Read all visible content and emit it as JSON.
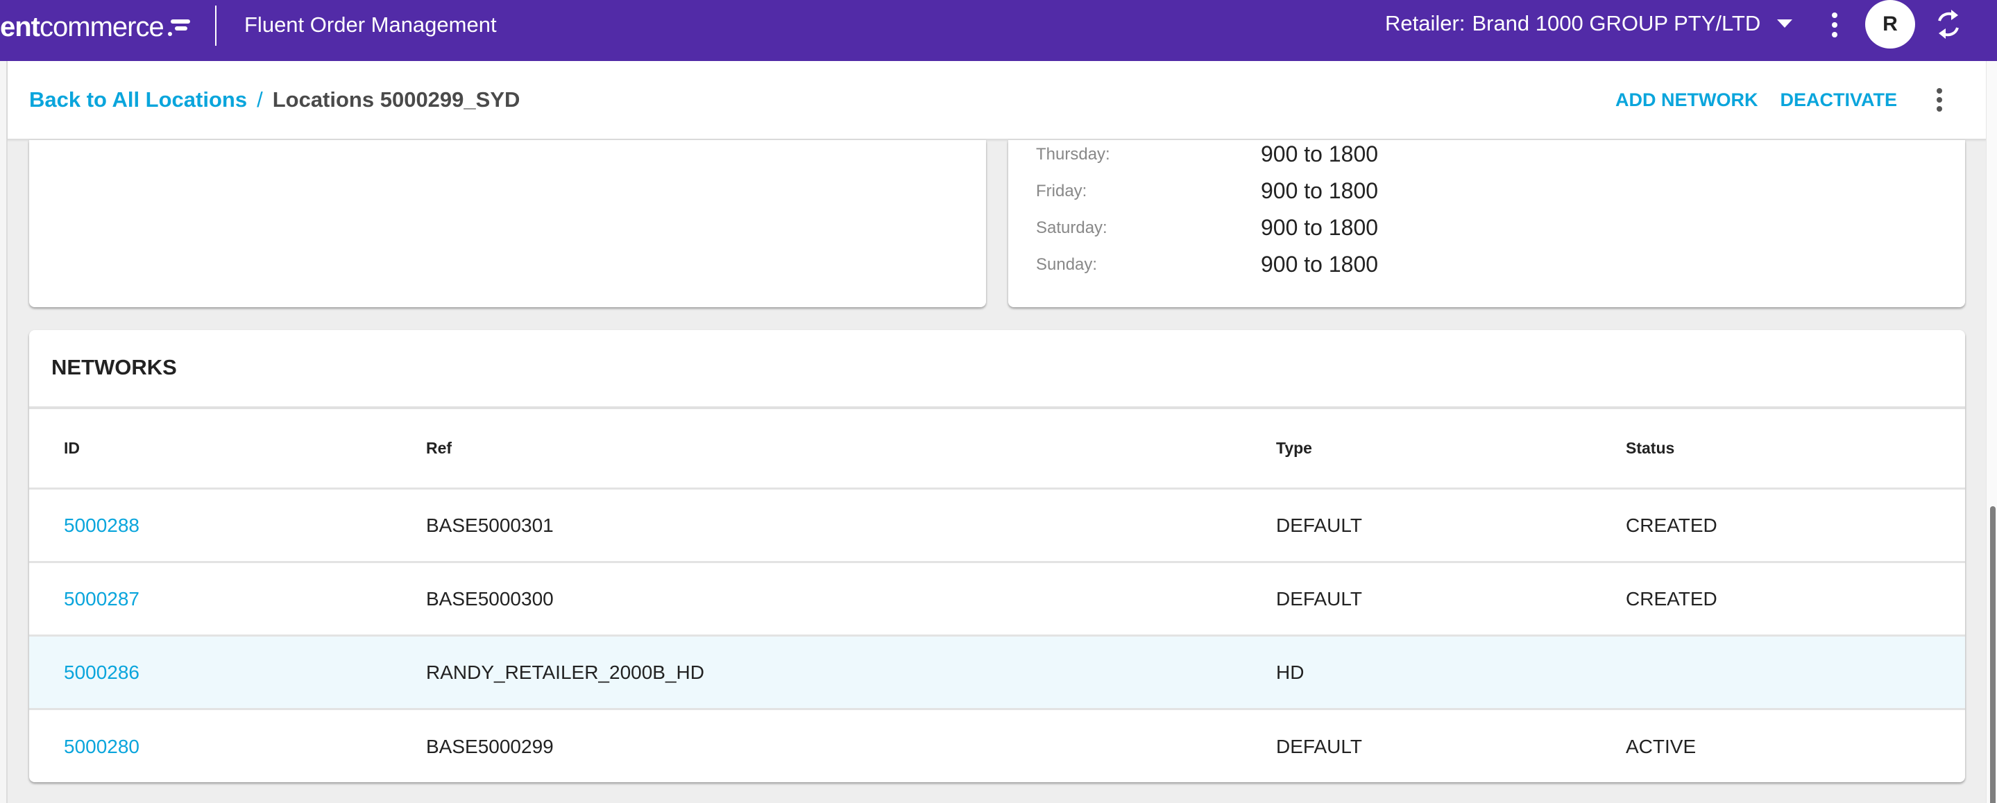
{
  "header": {
    "logo_text_bold": "ent",
    "logo_text_regular": "commerce",
    "app_title": "Fluent Order Management",
    "retailer_label": "Retailer:",
    "retailer_value": "Brand 1000 GROUP PTY/LTD",
    "avatar_initial": "R",
    "icons": {
      "menu": "more-vert-icon",
      "refresh": "refresh-icon",
      "dropdown": "caret-down-icon"
    },
    "colors": {
      "brand": "#522ba7"
    }
  },
  "breadcrumb": {
    "back_label": "Back to All Locations",
    "separator": "/",
    "current": "Locations 5000299_SYD"
  },
  "actions": {
    "add_network": "ADD NETWORK",
    "deactivate": "DEACTIVATE",
    "colors": {
      "link": "#0aa5dc"
    }
  },
  "opening_hours": [
    {
      "day": "Thursday:",
      "time": "900 to 1800"
    },
    {
      "day": "Friday:",
      "time": "900 to 1800"
    },
    {
      "day": "Saturday:",
      "time": "900 to 1800"
    },
    {
      "day": "Sunday:",
      "time": "900 to 1800"
    }
  ],
  "networks": {
    "title": "NETWORKS",
    "columns": [
      "ID",
      "Ref",
      "Type",
      "Status"
    ],
    "rows": [
      {
        "id": "5000288",
        "ref": "BASE5000301",
        "type": "DEFAULT",
        "status": "CREATED"
      },
      {
        "id": "5000287",
        "ref": "BASE5000300",
        "type": "DEFAULT",
        "status": "CREATED"
      },
      {
        "id": "5000286",
        "ref": "RANDY_RETAILER_2000B_HD",
        "type": "HD",
        "status": ""
      },
      {
        "id": "5000280",
        "ref": "BASE5000299",
        "type": "DEFAULT",
        "status": "ACTIVE"
      }
    ],
    "highlighted_row_index": 2,
    "colors": {
      "highlight": "#eef9fd"
    }
  }
}
